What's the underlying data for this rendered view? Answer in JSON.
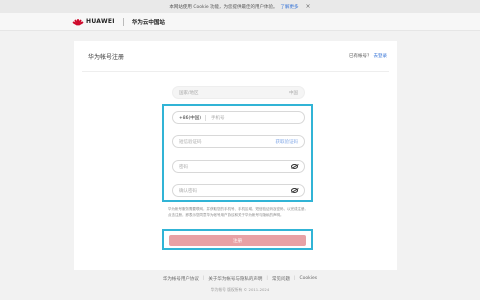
{
  "cookie_bar": {
    "text": "本网站使用 Cookie 功能，为您提供最佳的用户体验。",
    "link": "了解更多",
    "close": "×"
  },
  "header": {
    "brand": "HUAWEI",
    "site": "华为云中国站"
  },
  "card": {
    "title": "华为帐号注册",
    "have_account": "已有帐号？",
    "login_link": "去登录"
  },
  "form": {
    "region_placeholder": "国家/地区",
    "region_value": "中国",
    "phone_code": "+86(中国)",
    "phone_placeholder": "手机号",
    "sms_placeholder": "短信验证码",
    "sms_button": "获取验证码",
    "password_placeholder": "密码",
    "confirm_placeholder": "确认密码",
    "agreement": "华为帐号服务需要联网，并获取您的手机号、手机区域、短信验证码及密码，以完成注册。点击注册，即表示您同意华为帐号用户协议和关于华为帐号与隐私的声明。",
    "register_button": "注册"
  },
  "footer": {
    "links": [
      "华为帐号用户协议",
      "关于华为帐号与隐私的声明",
      "常见问题",
      "Cookies"
    ],
    "copyright": "华为帐号 版权所有 © 2011-2024"
  },
  "colors": {
    "highlight": "#31b4d6",
    "brand_red": "#cf0a2c",
    "button_disabled": "#e8a1a5",
    "link_blue": "#2f6fd6"
  }
}
